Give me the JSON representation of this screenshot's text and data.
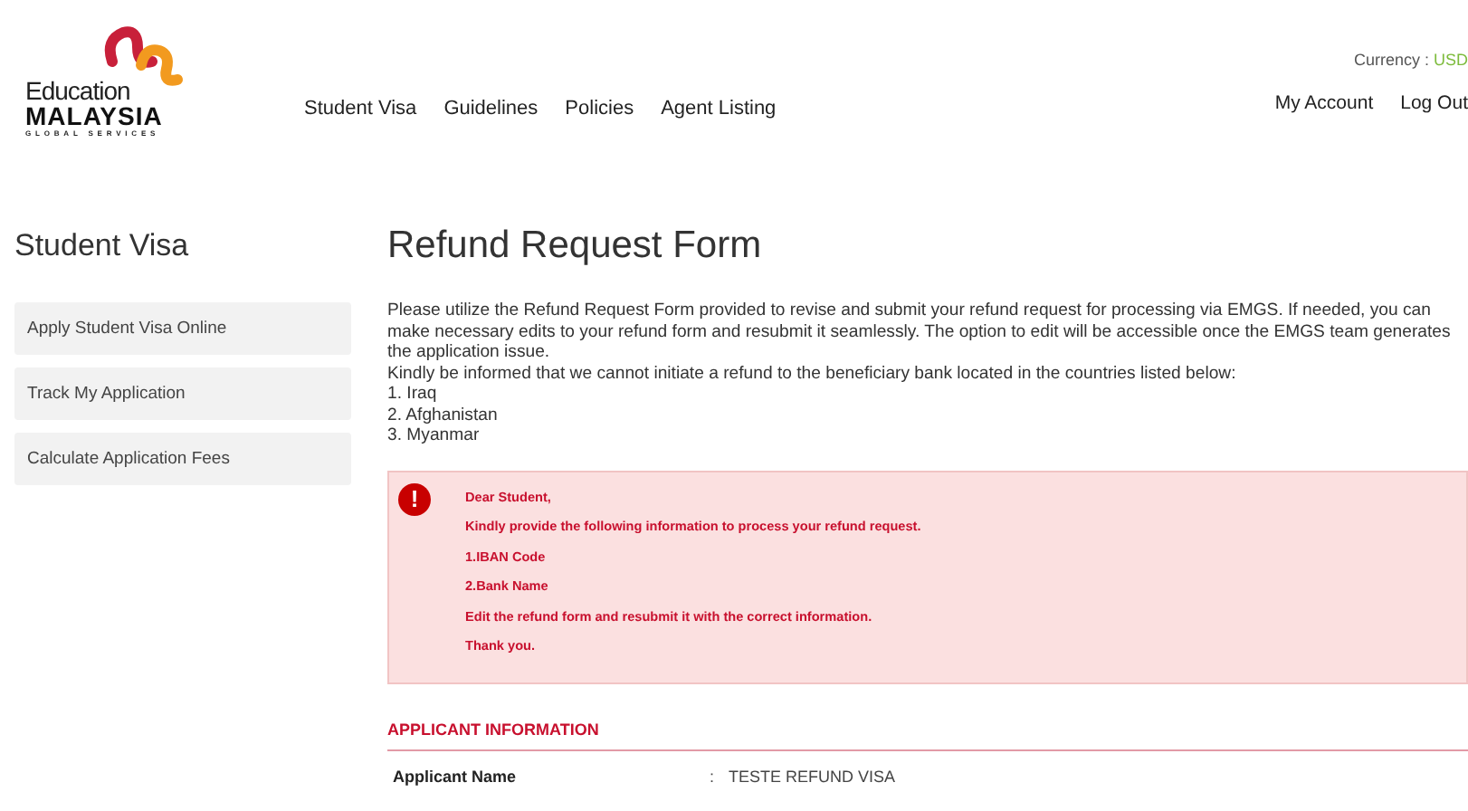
{
  "header": {
    "logo": {
      "word": "Education",
      "name": "MALAYSIA",
      "tagline": "GLOBAL SERVICES"
    },
    "nav": [
      "Student Visa",
      "Guidelines",
      "Policies",
      "Agent Listing"
    ],
    "currency": {
      "label": "Currency :",
      "value": "USD"
    },
    "account_links": [
      "My Account",
      "Log Out"
    ]
  },
  "sidebar": {
    "title": "Student Visa",
    "items": [
      "Apply Student Visa Online",
      "Track My Application",
      "Calculate Application Fees"
    ]
  },
  "main": {
    "title": "Refund Request Form",
    "intro": [
      "Please utilize the Refund Request Form provided to revise and submit your refund request for processing via EMGS. If needed, you can make necessary edits to your refund form and resubmit it seamlessly. The option to edit will be accessible once the EMGS team generates the application issue.",
      "Kindly be informed that we cannot initiate a refund to the beneficiary bank located in the countries listed below:",
      "1. Iraq",
      "2. Afghanistan",
      "3. Myanmar"
    ],
    "alert": {
      "icon": "!",
      "lines": [
        "Dear Student,",
        "Kindly provide the following information to process your refund request.",
        "1.IBAN Code",
        "2.Bank Name",
        "Edit the refund form and resubmit it with the correct information.",
        "Thank you."
      ]
    },
    "section_title": "APPLICANT INFORMATION",
    "fields": [
      {
        "label": "Applicant Name",
        "separator": ":",
        "value": "TESTE REFUND VISA"
      }
    ]
  }
}
